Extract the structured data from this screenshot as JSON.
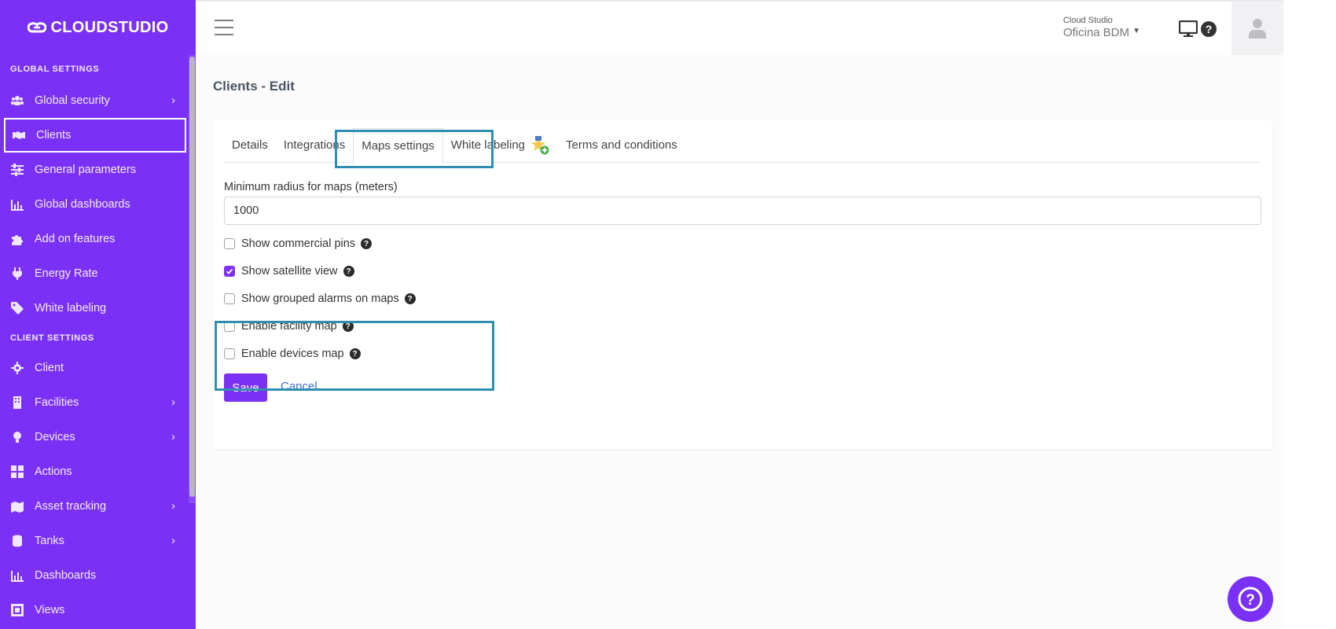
{
  "brand": {
    "name": "CLOUDSTUDIO"
  },
  "sidebar": {
    "global_title": "GLOBAL SETTINGS",
    "global_items": [
      {
        "label": "Global security",
        "icon": "users-icon",
        "has_submenu": true
      },
      {
        "label": "Clients",
        "icon": "handshake-icon",
        "active": true
      },
      {
        "label": "General parameters",
        "icon": "sliders-icon"
      },
      {
        "label": "Global dashboards",
        "icon": "bar-chart-icon"
      },
      {
        "label": "Add on features",
        "icon": "puzzle-icon"
      },
      {
        "label": "Energy Rate",
        "icon": "plug-icon"
      },
      {
        "label": "White labeling",
        "icon": "tag-icon"
      }
    ],
    "client_title": "CLIENT SETTINGS",
    "client_items": [
      {
        "label": "Client",
        "icon": "gear-icon"
      },
      {
        "label": "Facilities",
        "icon": "building-icon",
        "has_submenu": true
      },
      {
        "label": "Devices",
        "icon": "lightbulb-icon",
        "has_submenu": true
      },
      {
        "label": "Actions",
        "icon": "grid-icon"
      },
      {
        "label": "Asset tracking",
        "icon": "map-marker-icon",
        "has_submenu": true
      },
      {
        "label": "Tanks",
        "icon": "database-icon",
        "has_submenu": true
      },
      {
        "label": "Dashboards",
        "icon": "bar-chart-icon"
      },
      {
        "label": "Views",
        "icon": "object-group-icon"
      }
    ]
  },
  "topbar": {
    "org_name": "Cloud Studio",
    "org_sub": "Oficina BDM",
    "icons": [
      "monitor-icon",
      "help-circle-icon",
      "user-avatar-icon"
    ]
  },
  "page": {
    "title": "Clients - Edit",
    "tabs": [
      "Details",
      "Integrations",
      "Maps settings",
      "White labeling",
      "Terms and conditions"
    ],
    "active_tab": "Maps settings",
    "radius_label": "Minimum radius for maps (meters)",
    "radius_value": "1000",
    "checkboxes": [
      {
        "label": "Show commercial pins",
        "checked": false
      },
      {
        "label": "Show satellite view",
        "checked": true
      },
      {
        "label": "Show grouped alarms on maps",
        "checked": false
      },
      {
        "label": "Enable facility map",
        "checked": false
      },
      {
        "label": "Enable devices map",
        "checked": false
      }
    ],
    "save_label": "Save",
    "cancel_label": "Cancel"
  },
  "colors": {
    "primary": "#7b31f5",
    "highlight": "#2f8fb0",
    "link": "#3b6fd8"
  }
}
